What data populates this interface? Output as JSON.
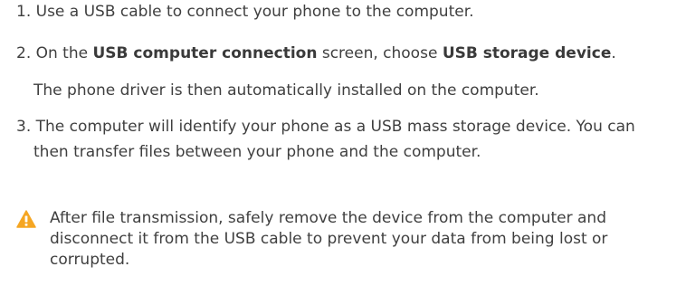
{
  "steps": [
    {
      "text": "1. Use a USB cable to connect your phone to the computer."
    },
    {
      "prefix": "2. On the ",
      "bold1": "USB computer connection",
      "middle": " screen, choose ",
      "bold2": "USB storage device",
      "suffix": ".",
      "subtext": "The phone driver is then automatically installed on the computer."
    },
    {
      "line1": "3. The computer will identify your phone as a USB mass storage device. You can",
      "line2": "then transfer files between your phone and the computer."
    }
  ],
  "note": {
    "icon": "warning-icon",
    "text": "After file transmission, safely remove the device from the computer and disconnect it from the USB cable to prevent your data from being lost or corrupted."
  },
  "colors": {
    "text": "#3f3f3f",
    "warning": "#f5a623"
  }
}
